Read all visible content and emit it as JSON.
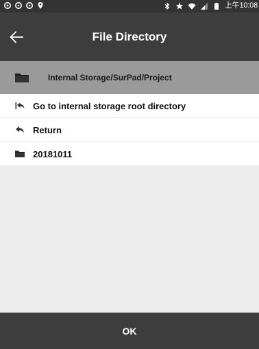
{
  "status_bar": {
    "time": "上午10:08",
    "icons": [
      "notification-icon",
      "notification-icon",
      "notification-icon",
      "location-icon",
      "bluetooth-icon",
      "star-icon",
      "wifi-icon",
      "signal-icon",
      "battery-icon"
    ]
  },
  "app_bar": {
    "title": "File Directory",
    "back_icon": "arrow-left-icon"
  },
  "path_bar": {
    "icon": "folder-icon",
    "path": "Internal Storage/SurPad/Project"
  },
  "list": {
    "items": [
      {
        "icon": "root-return-icon",
        "label": "Go to internal storage root directory"
      },
      {
        "icon": "return-icon",
        "label": "Return"
      },
      {
        "icon": "folder-icon",
        "label": "20181011"
      }
    ]
  },
  "footer": {
    "ok_label": "OK"
  },
  "colors": {
    "app_bar": "#3d3d3d",
    "path_bar": "#9a9a9a",
    "background": "#ececec",
    "list_item": "#ffffff"
  }
}
